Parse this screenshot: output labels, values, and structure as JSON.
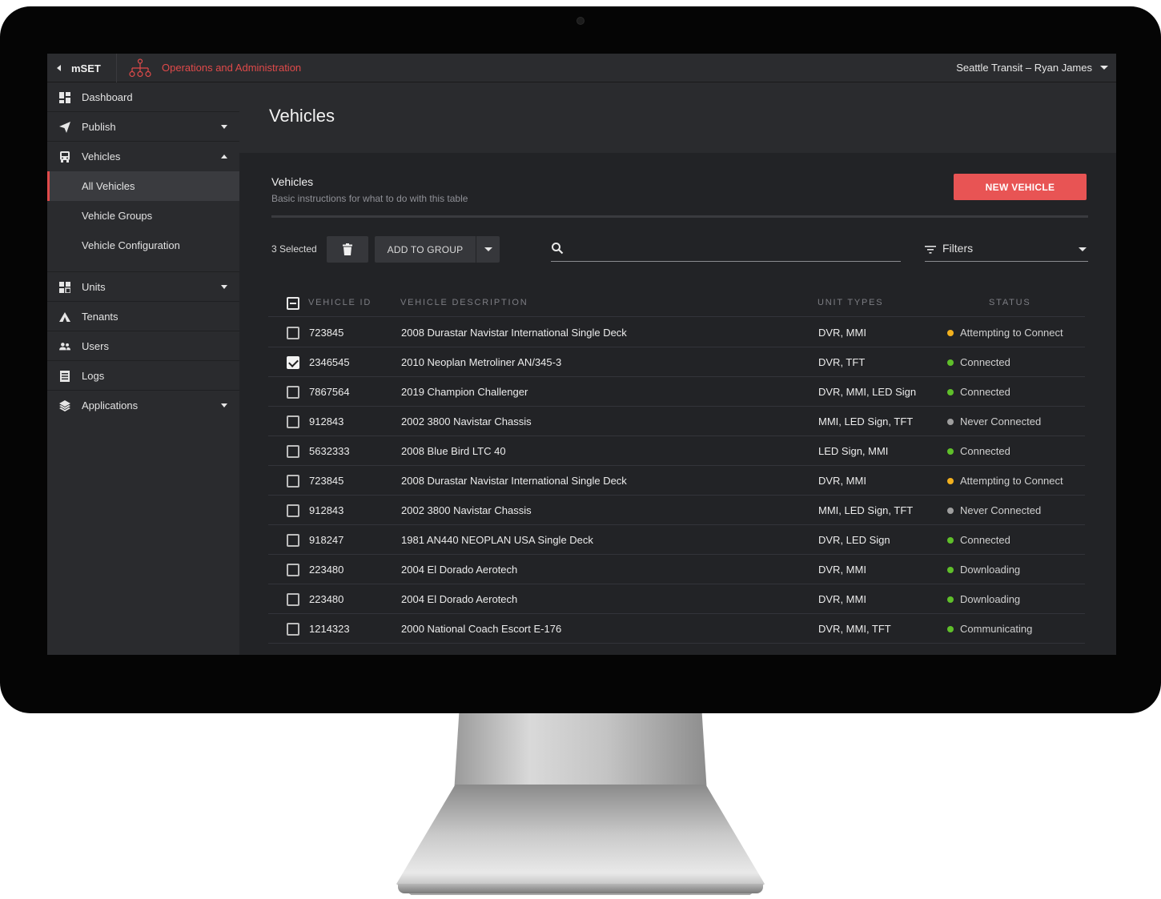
{
  "header": {
    "app_name": "mSET",
    "section_title": "Operations and Administration",
    "account": "Seattle Transit – Ryan James"
  },
  "sidebar": {
    "items": [
      {
        "label": "Dashboard",
        "icon": "dashboard-icon"
      },
      {
        "label": "Publish",
        "icon": "paper-plane-icon",
        "expandable": true,
        "expanded": false
      },
      {
        "label": "Vehicles",
        "icon": "bus-icon",
        "expandable": true,
        "expanded": true
      },
      {
        "label": "Units",
        "icon": "units-icon",
        "expandable": true,
        "expanded": false
      },
      {
        "label": "Tenants",
        "icon": "tent-icon"
      },
      {
        "label": "Users",
        "icon": "users-icon"
      },
      {
        "label": "Logs",
        "icon": "logs-icon"
      },
      {
        "label": "Applications",
        "icon": "layers-icon",
        "expandable": true,
        "expanded": false
      }
    ],
    "vehicles_sub": [
      {
        "label": "All Vehicles",
        "active": true
      },
      {
        "label": "Vehicle Groups",
        "active": false
      },
      {
        "label": "Vehicle Configuration",
        "active": false
      }
    ]
  },
  "page": {
    "title": "Vehicles",
    "card_title": "Vehicles",
    "card_subtitle": "Basic instructions for what to do with this table",
    "new_button": "NEW VEHICLE"
  },
  "toolbar": {
    "selected": "3 Selected",
    "add_to_group": "ADD TO GROUP",
    "search_value": "",
    "filters_label": "Filters"
  },
  "table": {
    "columns": [
      "VEHICLE ID",
      "VEHICLE DESCRIPTION",
      "UNIT TYPES",
      "STATUS"
    ],
    "status_colors": {
      "Attempting to Connect": "#f2b01e",
      "Connected": "#5fbf2a",
      "Never Connected": "#9e9e9e",
      "Downloading": "#5fbf2a",
      "Communicating": "#5fbf2a"
    },
    "rows": [
      {
        "id": "723845",
        "desc": "2008 Durastar Navistar International Single Deck",
        "units": "DVR, MMI",
        "status": "Attempting to Connect",
        "checked": false
      },
      {
        "id": "2346545",
        "desc": "2010 Neoplan Metroliner AN/345-3",
        "units": "DVR, TFT",
        "status": "Connected",
        "checked": true
      },
      {
        "id": "7867564",
        "desc": "2019 Champion Challenger",
        "units": "DVR, MMI, LED Sign",
        "status": "Connected",
        "checked": false
      },
      {
        "id": "912843",
        "desc": "2002 3800 Navistar Chassis",
        "units": "MMI, LED Sign, TFT",
        "status": "Never Connected",
        "checked": false
      },
      {
        "id": "5632333",
        "desc": "2008 Blue Bird LTC 40",
        "units": "LED Sign, MMI",
        "status": "Connected",
        "checked": false
      },
      {
        "id": "723845",
        "desc": "2008 Durastar Navistar International Single Deck",
        "units": "DVR, MMI",
        "status": "Attempting to Connect",
        "checked": false
      },
      {
        "id": "912843",
        "desc": "2002 3800 Navistar Chassis",
        "units": "MMI, LED Sign, TFT",
        "status": "Never Connected",
        "checked": false
      },
      {
        "id": "918247",
        "desc": "1981 AN440 NEOPLAN USA Single Deck",
        "units": "DVR, LED Sign",
        "status": "Connected",
        "checked": false
      },
      {
        "id": "223480",
        "desc": "2004 El Dorado Aerotech",
        "units": "DVR, MMI",
        "status": "Downloading",
        "checked": false
      },
      {
        "id": "223480",
        "desc": "2004 El Dorado Aerotech",
        "units": "DVR, MMI",
        "status": "Downloading",
        "checked": false
      },
      {
        "id": "1214323",
        "desc": "2000 National Coach Escort E-176",
        "units": "DVR, MMI, TFT",
        "status": "Communicating",
        "checked": false
      }
    ]
  }
}
